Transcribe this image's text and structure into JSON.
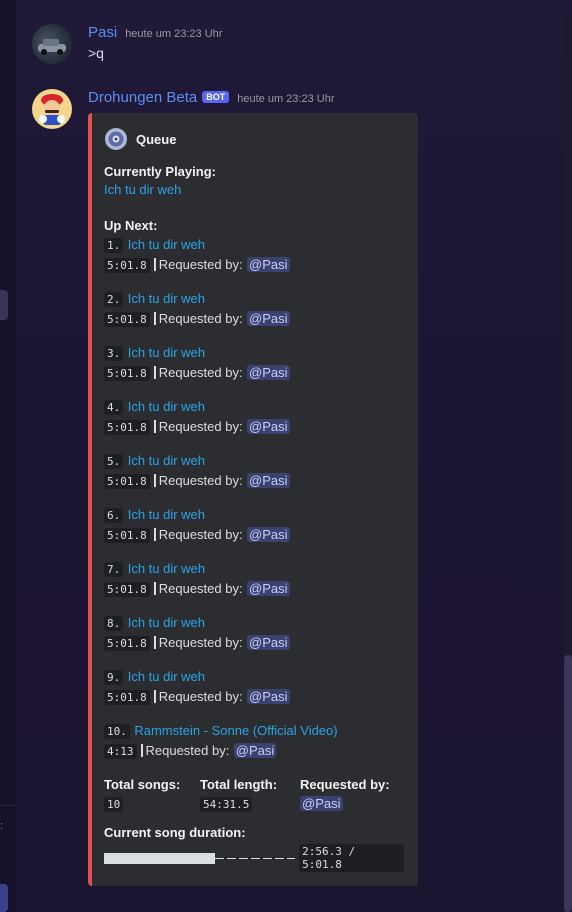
{
  "messages": [
    {
      "username": "Pasi",
      "timestamp": "heute um 23:23 Uhr",
      "text": ">q"
    },
    {
      "username": "Drohungen Beta",
      "bot_tag": "BOT",
      "timestamp": "heute um 23:23 Uhr"
    }
  ],
  "embed": {
    "accent_color": "#e05252",
    "author": "Queue",
    "author_icon": "music-disc-icon",
    "currently_playing_title": "Currently Playing:",
    "currently_playing": "Ich tu dir weh",
    "up_next_title": "Up Next:",
    "requested_by_prefix": "Requested by:",
    "queue": [
      {
        "number": "1.",
        "title": "Ich tu dir weh",
        "duration": "5:01.8",
        "requester": "@Pasi"
      },
      {
        "number": "2.",
        "title": "Ich tu dir weh",
        "duration": "5:01.8",
        "requester": "@Pasi"
      },
      {
        "number": "3.",
        "title": "Ich tu dir weh",
        "duration": "5:01.8",
        "requester": "@Pasi"
      },
      {
        "number": "4.",
        "title": "Ich tu dir weh",
        "duration": "5:01.8",
        "requester": "@Pasi"
      },
      {
        "number": "5.",
        "title": "Ich tu dir weh",
        "duration": "5:01.8",
        "requester": "@Pasi"
      },
      {
        "number": "6.",
        "title": "Ich tu dir weh",
        "duration": "5:01.8",
        "requester": "@Pasi"
      },
      {
        "number": "7.",
        "title": "Ich tu dir weh",
        "duration": "5:01.8",
        "requester": "@Pasi"
      },
      {
        "number": "8.",
        "title": "Ich tu dir weh",
        "duration": "5:01.8",
        "requester": "@Pasi"
      },
      {
        "number": "9.",
        "title": "Ich tu dir weh",
        "duration": "5:01.8",
        "requester": "@Pasi"
      },
      {
        "number": "10.",
        "title": "Rammstein - Sonne (Official Video)",
        "duration": "4:13",
        "requester": "@Pasi"
      }
    ],
    "total_songs_title": "Total songs:",
    "total_songs": "10",
    "total_length_title": "Total length:",
    "total_length": "54:31.5",
    "requested_by_title": "Requested by:",
    "requested_by": "@Pasi",
    "current_duration_title": "Current song duration:",
    "progress_fraction": 0.58,
    "progress_text": "2:56.3 / 5:01.8"
  }
}
